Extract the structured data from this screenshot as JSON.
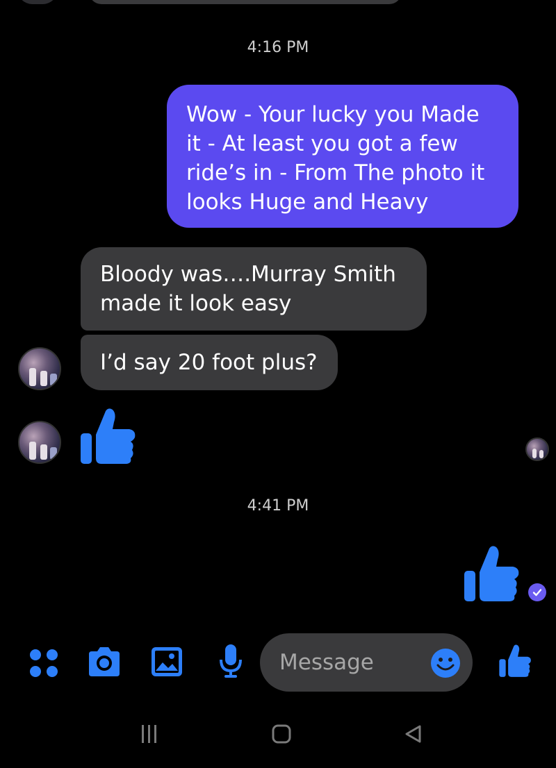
{
  "timestamps": [
    "4:16 PM",
    "4:41 PM"
  ],
  "messages": {
    "outgoing_1": "Wow - Your lucky you Made\nit - At least you got a few\nride’s in - From The photo it\nlooks Huge and Heavy",
    "incoming_1": "Bloody was….Murray Smith\nmade it look easy",
    "incoming_2": "I’d say 20 foot plus?"
  },
  "composer": {
    "placeholder": "Message"
  },
  "colors": {
    "background": "#000000",
    "outgoing_bubble": "#5b4af0",
    "incoming_bubble": "#3a3a3c",
    "accent_blue": "#2d7ff9"
  },
  "icons": {
    "composer": [
      "menu-dots-icon",
      "camera-icon",
      "gallery-icon",
      "microphone-icon",
      "emoji-icon",
      "thumbs-up-icon"
    ],
    "nav": [
      "recent-apps-icon",
      "home-icon",
      "back-icon"
    ]
  }
}
